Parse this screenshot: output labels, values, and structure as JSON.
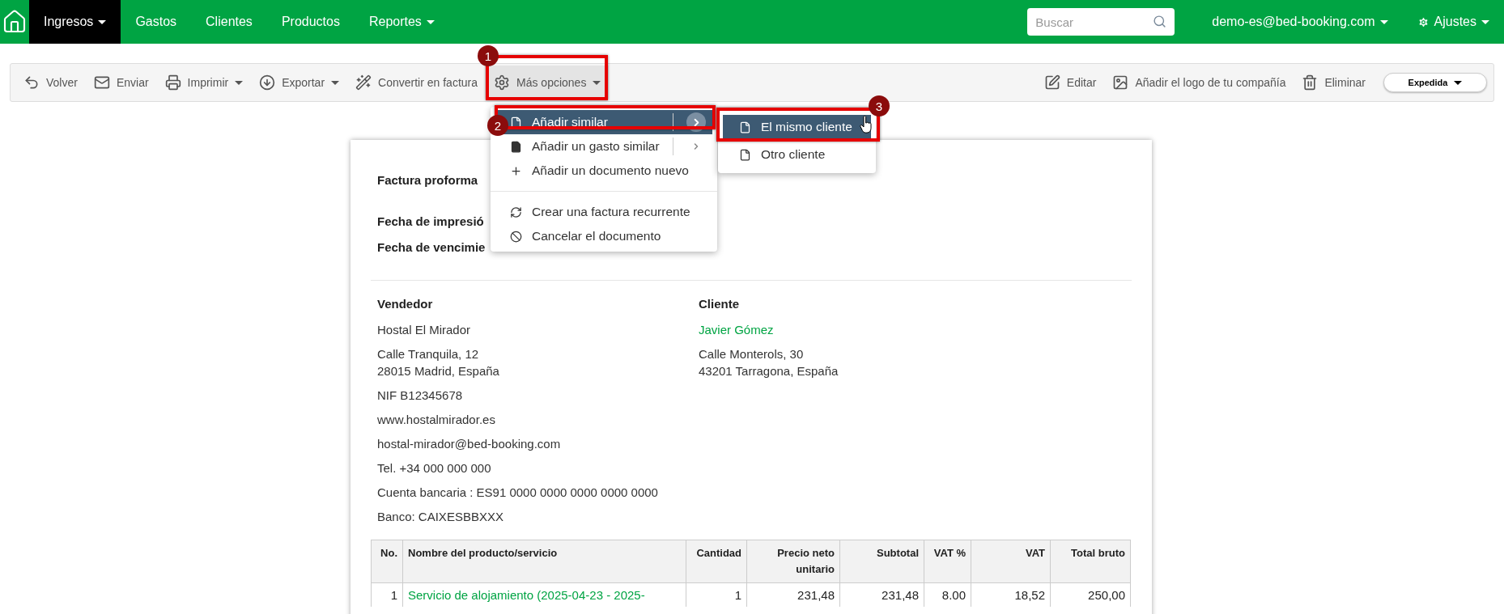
{
  "nav": {
    "items": [
      {
        "label": "Ingresos",
        "selected": true,
        "kind": "dropdown"
      },
      {
        "label": "Gastos",
        "selected": false,
        "kind": "link"
      },
      {
        "label": "Clientes",
        "selected": false,
        "kind": "link"
      },
      {
        "label": "Productos",
        "selected": false,
        "kind": "link"
      },
      {
        "label": "Reportes",
        "selected": false,
        "kind": "dropdown"
      }
    ],
    "search": {
      "placeholder": "Buscar"
    },
    "user": "demo-es@bed-booking.com",
    "settings": "Ajustes"
  },
  "toolbar": {
    "left": [
      {
        "label": "Volver",
        "kind": "button"
      },
      {
        "label": "Enviar",
        "kind": "button"
      },
      {
        "label": "Imprimir",
        "kind": "dropdown"
      },
      {
        "label": "Exportar",
        "kind": "dropdown"
      },
      {
        "label": "Convertir en factura",
        "kind": "button"
      },
      {
        "label": "Más opciones",
        "kind": "dropdown"
      }
    ],
    "right": [
      {
        "label": "Editar"
      },
      {
        "label": "Añadir el logo de tu compañía"
      },
      {
        "label": "Eliminar"
      }
    ],
    "status": "Expedida"
  },
  "menu": [
    {
      "label": "Añadir similar",
      "kind": "submenu",
      "selected": true
    },
    {
      "label": "Añadir un gasto similar",
      "kind": "submenu",
      "selected": false
    },
    {
      "label": "Añadir un documento nuevo",
      "kind": "action",
      "selected": false
    },
    {
      "kind": "divider"
    },
    {
      "label": "Crear una factura recurrente",
      "kind": "action",
      "selected": false
    },
    {
      "label": "Cancelar el documento",
      "kind": "action",
      "selected": false
    }
  ],
  "submenu": [
    {
      "label": "El mismo cliente",
      "selected": true
    },
    {
      "label": "Otro cliente",
      "selected": false
    }
  ],
  "annotations": [
    "1",
    "2",
    "3"
  ],
  "document": {
    "title": "Factura proforma",
    "dates": [
      "Fecha de impresió",
      "Fecha de vencimie"
    ],
    "seller": {
      "heading": "Vendedor",
      "lines": [
        [
          "Hostal El Mirador"
        ],
        [
          "Calle Tranquila, 12",
          "28015 Madrid, España"
        ],
        [
          "NIF B12345678"
        ],
        [
          "www.hostalmirador.es"
        ],
        [
          "hostal-mirador@bed-booking.com"
        ],
        [
          "Tel. +34 000 000 000"
        ],
        [
          "Cuenta bancaria : ES91 0000 0000 0000 0000 0000"
        ],
        [
          "Banco: CAIXESBBXXX"
        ]
      ]
    },
    "client": {
      "heading": "Cliente",
      "name": "Javier Gómez",
      "lines": [
        [
          "Calle Monterols, 30",
          "43201 Tarragona, España"
        ]
      ]
    },
    "table": {
      "columns": [
        "No.",
        "Nombre del producto/servicio",
        "Cantidad",
        "Precio neto unitario",
        "Subtotal",
        "VAT %",
        "VAT",
        "Total bruto"
      ],
      "rows": [
        [
          "1",
          "Servicio de alojamiento (2025-04-23 - 2025-",
          "1",
          "231,48",
          "231,48",
          "8.00",
          "18,52",
          "250,00"
        ]
      ]
    }
  }
}
